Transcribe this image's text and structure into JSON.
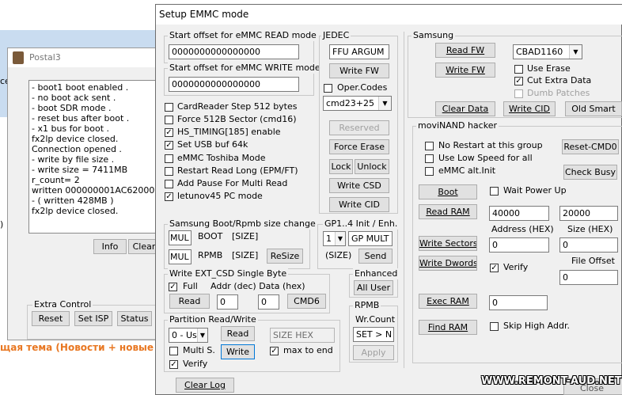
{
  "background": {
    "orange_text": "щая тема (Новости + новые ве"
  },
  "postal": {
    "title": "Postal3",
    "log_lines": [
      "- boot1 boot enabled .",
      "- no boot ack sent .",
      "- boot SDR mode .",
      "- reset bus after boot .",
      "- x1 bus for boot .",
      "fx2lp device closed.",
      "Connection opened .",
      "- write by file size .",
      "- write size = 7411MB",
      "r_count= 2",
      "written 000000001AC62000",
      "- ( written 428MB )",
      "fx2lp device closed."
    ],
    "info_button": "Info",
    "clear_button": "Clear",
    "extra_control_label": "Extra Control",
    "reset_button": "Reset",
    "set_isp_button": "Set ISP",
    "status_button": "Status",
    "left_edge_text": "ce",
    "left_edge_text2": ")"
  },
  "dialog": {
    "title": "Setup EMMC mode",
    "read_offset_label": "Start offset for eMMC READ mode",
    "read_offset_value": "0000000000000000",
    "write_offset_label": "Start offset for eMMC WRITE mode",
    "write_offset_value": "0000000000000000",
    "options": [
      {
        "label": "CardReader Step 512 bytes",
        "checked": false
      },
      {
        "label": "Force 512B Sector (cmd16)",
        "checked": false
      },
      {
        "label": "HS_TIMING[185] enable",
        "checked": true
      },
      {
        "label": "Set USB buf 64k",
        "checked": true
      },
      {
        "label": "eMMC Toshiba Mode",
        "checked": false
      },
      {
        "label": "Restart Read Long (EPM/FT)",
        "checked": false
      },
      {
        "label": "Add Pause For Multi Read",
        "checked": false
      },
      {
        "label": "letunov45 PC mode",
        "checked": true
      }
    ],
    "jedec": {
      "label": "JEDEC",
      "value": "FFU ARGUM",
      "write_fw": "Write FW",
      "oper_codes": "Oper.Codes",
      "cmd_select": "cmd23+25",
      "reserved": "Reserved",
      "force_erase": "Force Erase",
      "lock": "Lock",
      "unlock": "Unlock",
      "write_csd": "Write CSD",
      "write_cid": "Write CID"
    },
    "boot_rpmb": {
      "label": "Samsung Boot/Rpmb size change",
      "mul1": "MUL",
      "boot": "BOOT",
      "size1": "[SIZE]",
      "mul2": "MUL",
      "rpmb": "RPMB",
      "size2": "[SIZE]",
      "resize": "ReSize"
    },
    "gp": {
      "label": "GP1..4 Init / Enh.",
      "select": "1",
      "value": "GP MULT",
      "size": "(SIZE)",
      "send": "Send"
    },
    "ext_csd": {
      "label": "Write EXT_CSD Single Byte",
      "full": "Full",
      "addr_data_label": "Addr (dec) Data (hex)",
      "read": "Read",
      "addr_value": "0",
      "data_value": "0",
      "cmd6": "CMD6"
    },
    "enhanced": {
      "label": "Enhanced",
      "all_user": "All User"
    },
    "rpmb": {
      "label": "RPMB",
      "wr_count": "Wr.Count",
      "set_n": "SET > N",
      "apply": "Apply"
    },
    "partition": {
      "label": "Partition Read/Write",
      "select": "0 - Us",
      "read": "Read",
      "size_hex": "SIZE HEX",
      "multi_s": "Multi S.",
      "write": "Write",
      "max_to_end": "max to end",
      "verify": "Verify"
    },
    "clear_log": "Clear Log",
    "close_partial": "Close",
    "samsung": {
      "label": "Samsung",
      "read_fw": "Read FW",
      "write_fw": "Write FW",
      "fw_select": "CBAD1160",
      "use_erase": "Use Erase",
      "cut_extra_data": "Cut Extra Data",
      "dumb_patches": "Dumb Patches",
      "clear_data": "Clear Data",
      "write_cid": "Write CID",
      "old_smart": "Old Smart"
    },
    "movinand": {
      "label": "moviNAND hacker",
      "no_restart": "No Restart at this group",
      "low_speed": "Use Low Speed for all",
      "emmc_alt": "eMMC alt.Init",
      "reset_cmd0": "Reset-CMD0",
      "check_busy": "Check Busy",
      "boot": "Boot",
      "wait_power_up": "Wait Power Up",
      "read_ram": "Read RAM",
      "ram_addr": "40000",
      "ram_size": "20000",
      "address_hex": "Address (HEX)",
      "size_hex": "Size (HEX)",
      "write_sectors": "Write Sectors",
      "ws_addr": "0",
      "ws_size": "0",
      "write_dwords": "Write Dwords",
      "verify": "Verify",
      "file_offset": "File Offset",
      "file_offset_value": "0",
      "exec_ram": "Exec RAM",
      "exec_value": "0",
      "find_ram": "Find RAM",
      "skip_high_addr": "Skip High Addr."
    }
  },
  "watermark": "WWW.REMONT-AUD.NET"
}
